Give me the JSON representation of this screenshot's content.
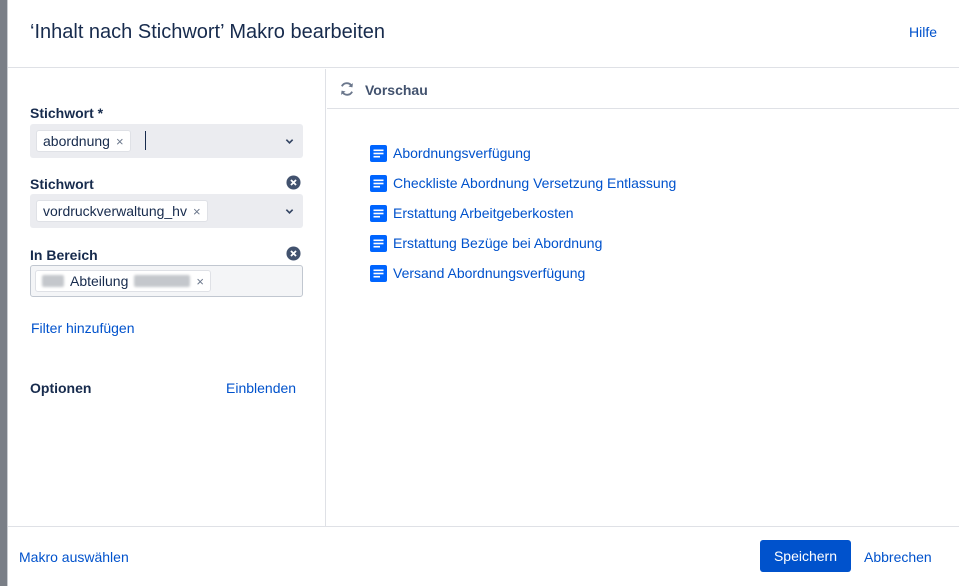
{
  "dialog": {
    "title": "‘Inhalt nach Stichwort’ Makro bearbeiten",
    "help_label": "Hilfe"
  },
  "form": {
    "field1": {
      "label": "Stichwort *",
      "chip": "abordnung"
    },
    "field2": {
      "label": "Stichwort",
      "chip": "vordruckverwaltung_hv"
    },
    "field3": {
      "label": "In Bereich",
      "chip": "Abteilung"
    },
    "add_filter_label": "Filter hinzufügen",
    "options_label": "Optionen",
    "options_toggle_label": "Einblenden",
    "remove_glyph": "×"
  },
  "preview": {
    "label": "Vorschau",
    "results": [
      "Abordnungsverfügung",
      "Checkliste Abordnung Versetzung Entlassung",
      "Erstattung Arbeitgeberkosten",
      "Erstattung Bezüge bei Abordnung",
      "Versand Abordnungsverfügung"
    ]
  },
  "footer": {
    "select_macro_label": "Makro auswählen",
    "save_label": "Speichern",
    "cancel_label": "Abbrechen"
  },
  "icons": {
    "refresh": "refresh-icon",
    "page": "page-icon",
    "clear": "clear-circle-icon",
    "chevron": "chevron-down-icon"
  },
  "colors": {
    "link": "#0052cc",
    "primary_button": "#0052cc",
    "text": "#172b4d",
    "select_bg": "#ebecf0"
  }
}
